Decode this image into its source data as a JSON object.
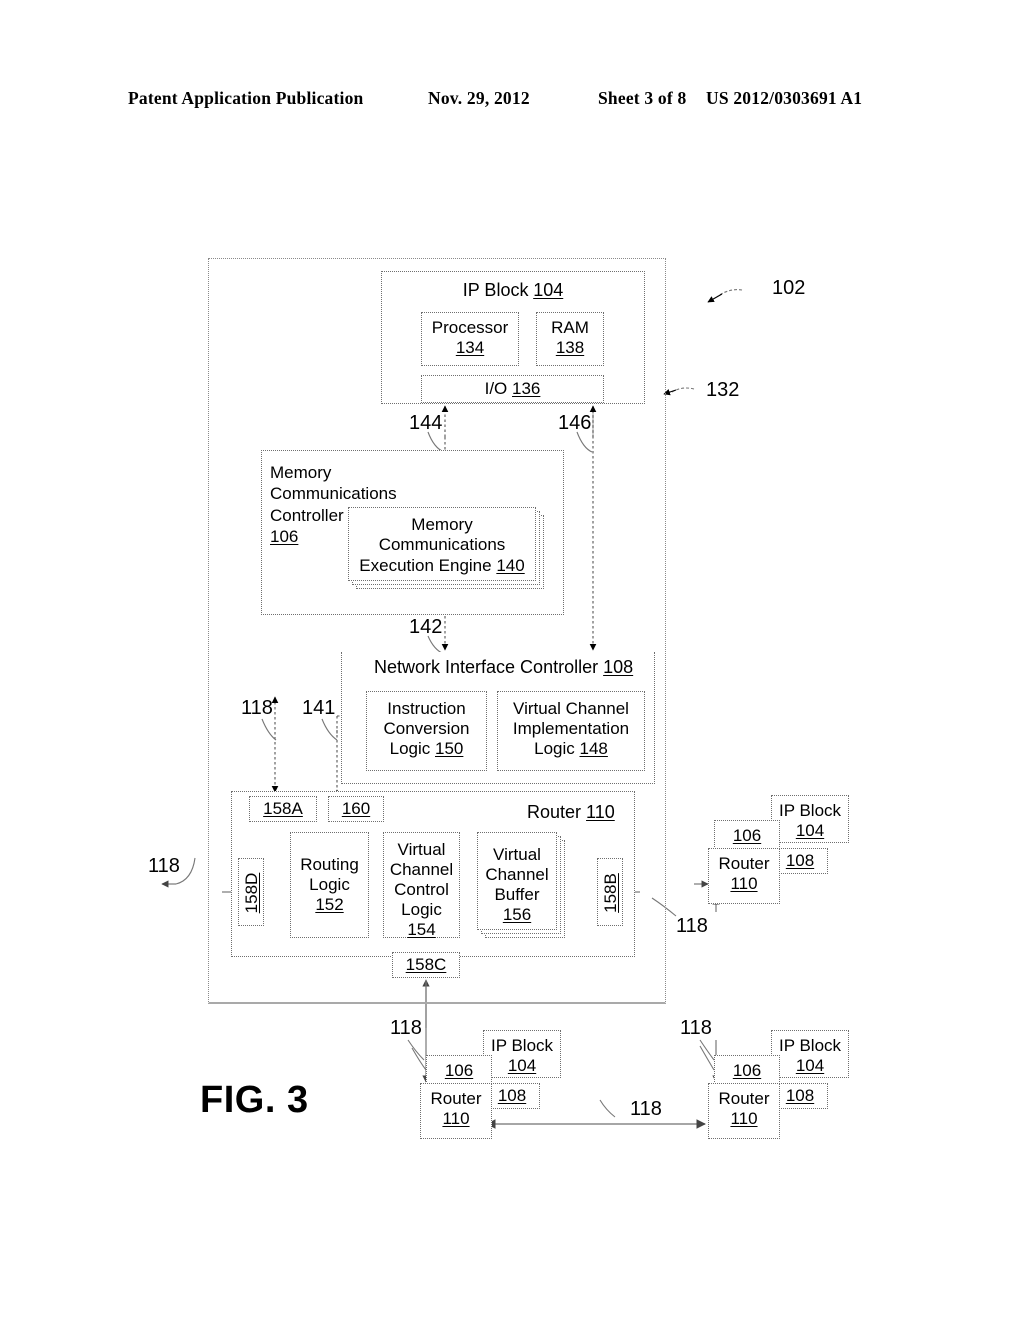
{
  "header": {
    "publication": "Patent Application Publication",
    "date": "Nov. 29, 2012",
    "sheet": "Sheet 3 of 8",
    "document_number": "US 2012/0303691 A1"
  },
  "figure": {
    "caption": "FIG. 3"
  },
  "ip_block": {
    "title": "IP Block",
    "title_ref": "104",
    "processor": {
      "label": "Processor",
      "ref": "134"
    },
    "ram": {
      "label": "RAM",
      "ref": "138"
    },
    "io": {
      "label": "I/O",
      "ref": "136"
    }
  },
  "memory_controller": {
    "line1": "Memory",
    "line2": "Communications",
    "line3": "Controller",
    "ref": "106",
    "engine": {
      "line1": "Memory",
      "line2": "Communications",
      "line3": "Execution Engine",
      "ref": "140"
    }
  },
  "network_interface_controller": {
    "title": "Network Interface Controller",
    "title_ref": "108",
    "instruction_conversion_logic": {
      "line1": "Instruction",
      "line2": "Conversion",
      "line3": "Logic",
      "ref": "150"
    },
    "virtual_channel_implementation_logic": {
      "line1": "Virtual Channel",
      "line2": "Implementation",
      "line3": "Logic",
      "ref": "148"
    }
  },
  "router": {
    "title": "Router",
    "title_ref": "110",
    "ports": {
      "north": "158A",
      "east": "158B",
      "south": "158C",
      "west": "158D",
      "ip_port": "160"
    },
    "routing_logic": {
      "line1": "Routing",
      "line2": "Logic",
      "ref": "152"
    },
    "virtual_channel_control_logic": {
      "line1": "Virtual",
      "line2": "Channel",
      "line3": "Control",
      "line4": "Logic",
      "ref": "154"
    },
    "virtual_channel_buffer": {
      "line1": "Virtual",
      "line2": "Channel",
      "line3": "Buffer",
      "ref": "156"
    }
  },
  "nodes": {
    "right": {
      "ip_block": "IP Block",
      "ip_block_ref": "104",
      "memory_controller_ref": "106",
      "nic_ref": "108",
      "router": "Router",
      "router_ref": "110",
      "link_ref": "118"
    },
    "bottom_left": {
      "ip_block": "IP Block",
      "ip_block_ref": "104",
      "memory_controller_ref": "106",
      "nic_ref": "108",
      "router": "Router",
      "router_ref": "110",
      "link_ref": "118"
    },
    "bottom_right": {
      "ip_block": "IP Block",
      "ip_block_ref": "104",
      "memory_controller_ref": "106",
      "nic_ref": "108",
      "router": "Router",
      "router_ref": "110",
      "link_ref": "118"
    }
  },
  "reference_numerals": {
    "noc": "102",
    "ip_block_boundary": "132",
    "mcc_to_ip_left": "144",
    "nic_to_ip_right": "146",
    "mcc_to_nic": "142",
    "nic_to_router_port": "141",
    "link_left": "118",
    "link_router_top": "118",
    "link_right_node": "118",
    "link_bottom_left": "118",
    "link_bottom_middle": "118",
    "link_bottom_right": "118"
  },
  "colors": {
    "ink": "#000000",
    "line": "#6f6f6f",
    "boundary": "#8a8a8a",
    "paper": "#ffffff"
  }
}
